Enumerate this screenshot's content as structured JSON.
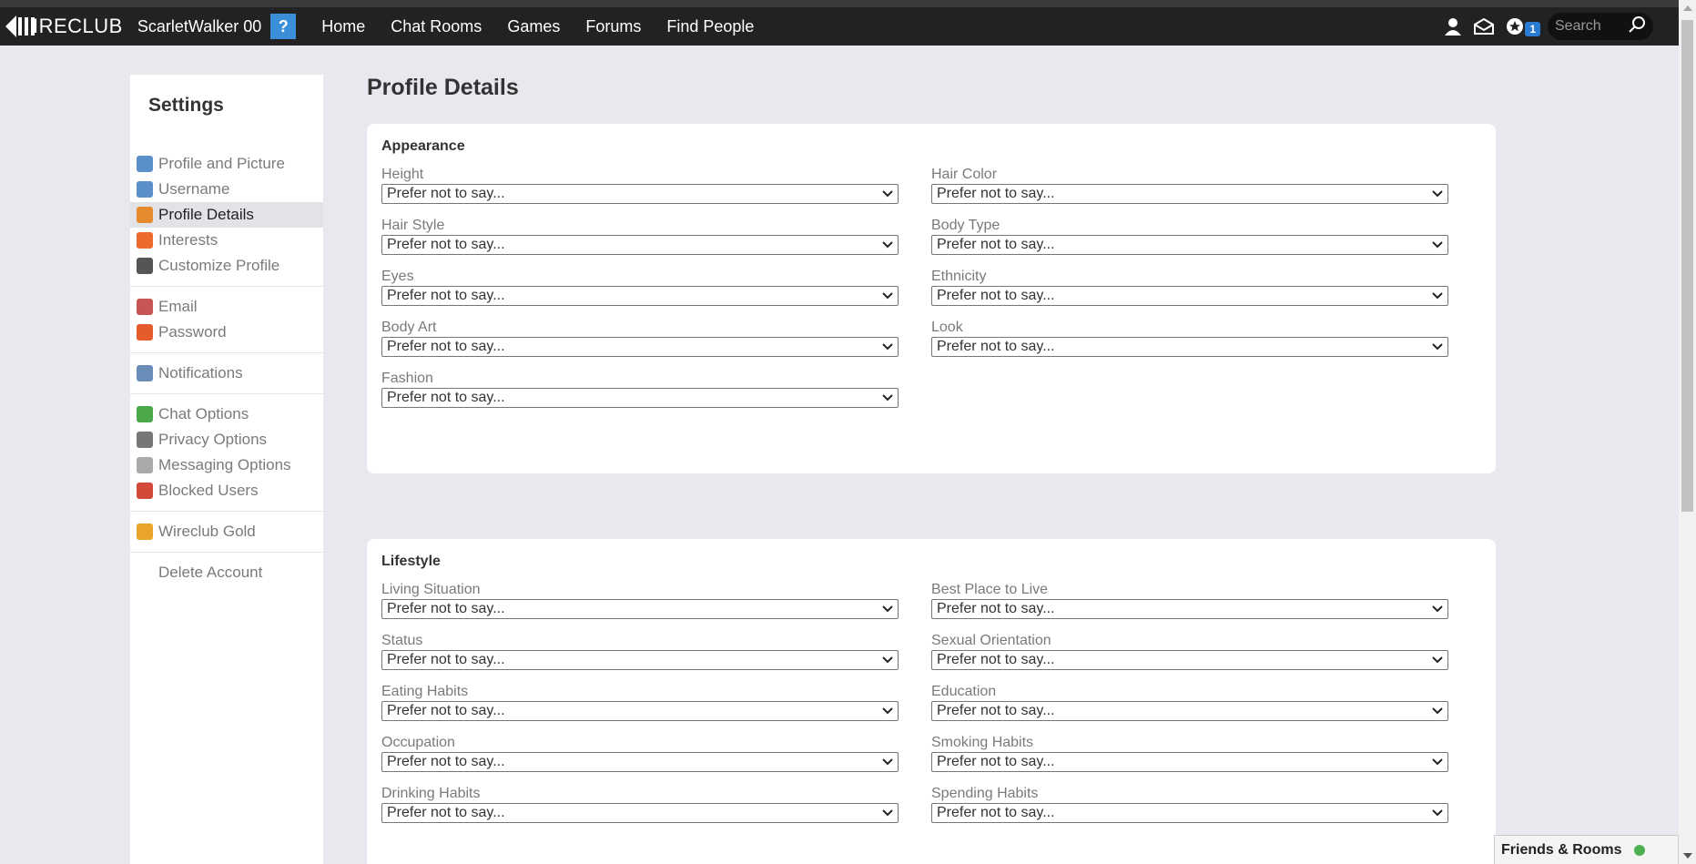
{
  "topbar": {
    "logo_text": "IRECLUB",
    "username": "ScarletWalker 00",
    "help_label": "?",
    "nav": [
      "Home",
      "Chat Rooms",
      "Games",
      "Forums",
      "Find People"
    ],
    "notification_count": "1",
    "search_placeholder": "Search"
  },
  "sidebar": {
    "title": "Settings",
    "groups": [
      [
        {
          "label": "Profile and Picture",
          "icon": "profile-picture-icon",
          "color": "#5b8fc9"
        },
        {
          "label": "Username",
          "icon": "user-icon",
          "color": "#5b8fc9"
        },
        {
          "label": "Profile Details",
          "icon": "details-icon",
          "color": "#e58a2e",
          "active": true
        },
        {
          "label": "Interests",
          "icon": "heart-icon",
          "color": "#ee6a2a"
        },
        {
          "label": "Customize Profile",
          "icon": "customize-icon",
          "color": "#555555"
        }
      ],
      [
        {
          "label": "Email",
          "icon": "email-icon",
          "color": "#c85454"
        },
        {
          "label": "Password",
          "icon": "lock-icon",
          "color": "#e55b2b"
        }
      ],
      [
        {
          "label": "Notifications",
          "icon": "notifications-icon",
          "color": "#6a8db8"
        }
      ],
      [
        {
          "label": "Chat Options",
          "icon": "chat-icon",
          "color": "#4aa84a"
        },
        {
          "label": "Privacy Options",
          "icon": "privacy-icon",
          "color": "#777777"
        },
        {
          "label": "Messaging Options",
          "icon": "envelope-icon",
          "color": "#aaaaaa"
        },
        {
          "label": "Blocked Users",
          "icon": "blocked-icon",
          "color": "#d44a3a"
        }
      ],
      [
        {
          "label": "Wireclub Gold",
          "icon": "gold-icon",
          "color": "#e8a52a"
        }
      ],
      [
        {
          "label": "Delete Account",
          "icon": "",
          "color": ""
        }
      ]
    ]
  },
  "main": {
    "title": "Profile Details",
    "sections": [
      {
        "title": "Appearance",
        "fields": [
          {
            "label": "Height",
            "value": "Prefer not to say..."
          },
          {
            "label": "Hair Color",
            "value": "Prefer not to say..."
          },
          {
            "label": "Hair Style",
            "value": "Prefer not to say..."
          },
          {
            "label": "Body Type",
            "value": "Prefer not to say..."
          },
          {
            "label": "Eyes",
            "value": "Prefer not to say..."
          },
          {
            "label": "Ethnicity",
            "value": "Prefer not to say..."
          },
          {
            "label": "Body Art",
            "value": "Prefer not to say..."
          },
          {
            "label": "Look",
            "value": "Prefer not to say..."
          },
          {
            "label": "Fashion",
            "value": "Prefer not to say..."
          }
        ]
      },
      {
        "title": "Lifestyle",
        "fields": [
          {
            "label": "Living Situation",
            "value": "Prefer not to say..."
          },
          {
            "label": "Best Place to Live",
            "value": "Prefer not to say..."
          },
          {
            "label": "Status",
            "value": "Prefer not to say..."
          },
          {
            "label": "Sexual Orientation",
            "value": "Prefer not to say..."
          },
          {
            "label": "Eating Habits",
            "value": "Prefer not to say..."
          },
          {
            "label": "Education",
            "value": "Prefer not to say..."
          },
          {
            "label": "Occupation",
            "value": "Prefer not to say..."
          },
          {
            "label": "Smoking Habits",
            "value": "Prefer not to say..."
          },
          {
            "label": "Drinking Habits",
            "value": "Prefer not to say..."
          },
          {
            "label": "Spending Habits",
            "value": "Prefer not to say..."
          }
        ]
      }
    ]
  },
  "friends_bar": {
    "label": "Friends & Rooms",
    "status_color": "#4caf50"
  }
}
